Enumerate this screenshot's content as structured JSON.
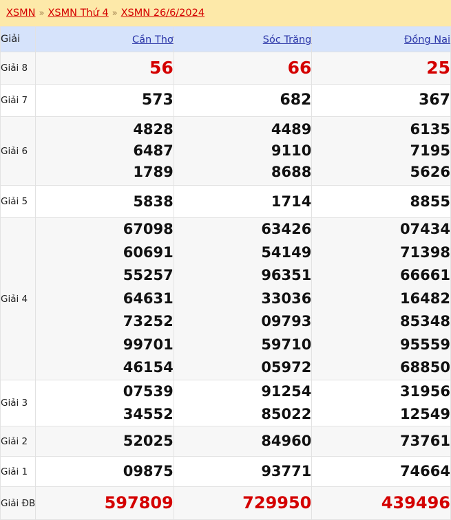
{
  "breadcrumb": {
    "separator": "»",
    "items": [
      {
        "label": "XSMN"
      },
      {
        "label": "XSMN Thứ 4"
      },
      {
        "label": "XSMN 26/6/2024"
      }
    ],
    "background_color": "#fde9a9",
    "link_color": "#d40000"
  },
  "table": {
    "header": {
      "label_column": "Giải",
      "provinces": [
        {
          "name": "Cần Thơ"
        },
        {
          "name": "Sóc Trăng"
        },
        {
          "name": "Đồng Nai"
        }
      ],
      "background_color": "#d6e3fb",
      "link_color": "#2b36a8"
    },
    "highlight_color": "#d40000",
    "rows": [
      {
        "label": "Giải 8",
        "cells": [
          [
            "56"
          ],
          [
            "66"
          ],
          [
            "25"
          ]
        ]
      },
      {
        "label": "Giải 7",
        "cells": [
          [
            "573"
          ],
          [
            "682"
          ],
          [
            "367"
          ]
        ]
      },
      {
        "label": "Giải 6",
        "cells": [
          [
            "4828",
            "6487",
            "1789"
          ],
          [
            "4489",
            "9110",
            "8688"
          ],
          [
            "6135",
            "7195",
            "5626"
          ]
        ]
      },
      {
        "label": "Giải 5",
        "cells": [
          [
            "5838"
          ],
          [
            "1714"
          ],
          [
            "8855"
          ]
        ]
      },
      {
        "label": "Giải 4",
        "cells": [
          [
            "67098",
            "60691",
            "55257",
            "64631",
            "73252",
            "99701",
            "46154"
          ],
          [
            "63426",
            "54149",
            "96351",
            "33036",
            "09793",
            "59710",
            "05972"
          ],
          [
            "07434",
            "71398",
            "66661",
            "16482",
            "85348",
            "95559",
            "68850"
          ]
        ]
      },
      {
        "label": "Giải 3",
        "cells": [
          [
            "07539",
            "34552"
          ],
          [
            "91254",
            "85022"
          ],
          [
            "31956",
            "12549"
          ]
        ]
      },
      {
        "label": "Giải 2",
        "cells": [
          [
            "52025"
          ],
          [
            "84960"
          ],
          [
            "73761"
          ]
        ]
      },
      {
        "label": "Giải 1",
        "cells": [
          [
            "09875"
          ],
          [
            "93771"
          ],
          [
            "74664"
          ]
        ]
      },
      {
        "label": "Giải ĐB",
        "cells": [
          [
            "597809"
          ],
          [
            "729950"
          ],
          [
            "439496"
          ]
        ]
      }
    ]
  }
}
